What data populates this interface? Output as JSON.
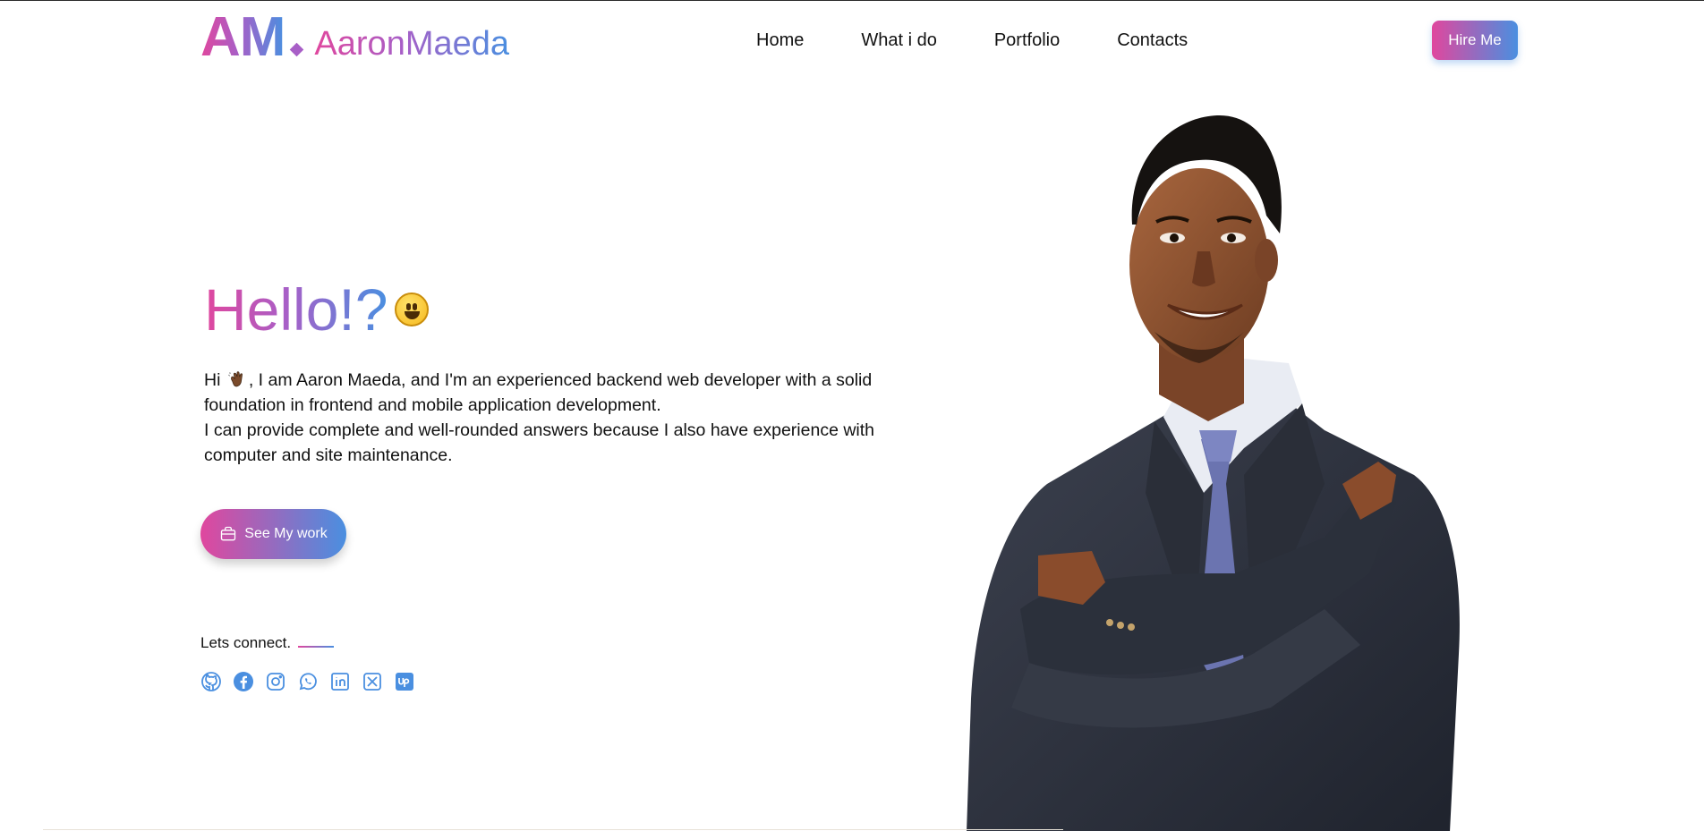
{
  "brand": {
    "mark": "AM",
    "name": "AaronMaeda"
  },
  "nav": {
    "items": [
      "Home",
      "What i do",
      "Portfolio",
      "Contacts"
    ]
  },
  "header": {
    "hire_label": "Hire Me"
  },
  "hero": {
    "greeting": "Hello!?",
    "intro_p1_before": "Hi ",
    "intro_p1_after": ", I am Aaron Maeda, and I'm an experienced backend web developer with a solid foundation in frontend and mobile application development.",
    "intro_p2": "I can provide complete and well-rounded answers because I also have experience with computer and site maintenance.",
    "cta_label": "See My work",
    "connect_label": "Lets connect."
  },
  "socials": [
    "github-icon",
    "facebook-icon",
    "instagram-icon",
    "whatsapp-icon",
    "linkedin-icon",
    "x-icon",
    "upwork-icon"
  ],
  "colors": {
    "gradient_start": "#e0479e",
    "gradient_mid": "#a85fc7",
    "gradient_end": "#4a8fe0",
    "social": "#4a8fe0"
  }
}
